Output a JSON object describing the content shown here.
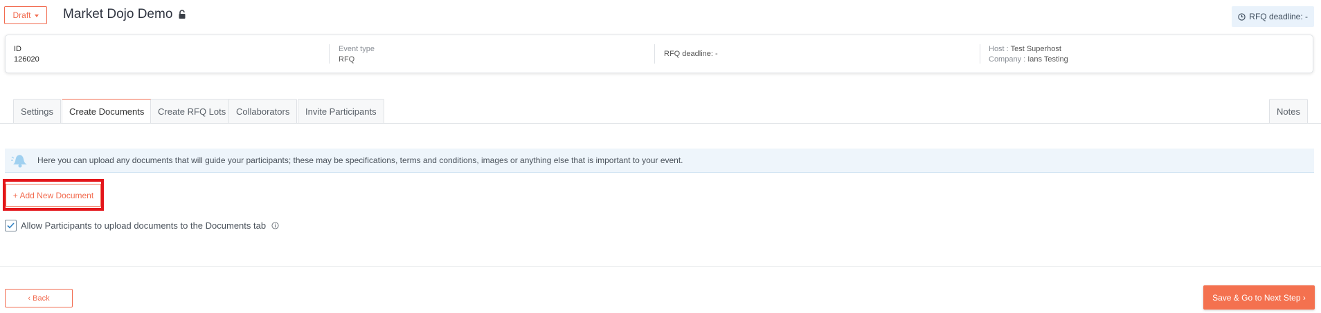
{
  "header": {
    "status_label": "Draft",
    "event_title": "Market Dojo Demo",
    "deadline_label": "RFQ deadline: -"
  },
  "info_card": {
    "id_label": "ID",
    "id_value": "126020",
    "event_type_label": "Event type",
    "event_type_value": "RFQ",
    "rfq_deadline": "RFQ deadline: -",
    "host_label": "Host : ",
    "host_value": "Test Superhost",
    "company_label": "Company : ",
    "company_value": "Ians Testing"
  },
  "tabs": [
    {
      "label": "Settings"
    },
    {
      "label": "Create Documents",
      "active": true
    },
    {
      "label": "Create RFQ Lots"
    },
    {
      "label": "Collaborators"
    },
    {
      "label": "Invite Participants"
    },
    {
      "label": "Notes"
    }
  ],
  "banner": {
    "text": "Here you can upload any documents that will guide your participants; these may be specifications, terms and conditions, images or anything else that is important to your event."
  },
  "documents": {
    "add_button_label": "+ Add New Document",
    "allow_upload_label": "Allow Participants to upload documents to the Documents tab",
    "allow_upload_checked": true
  },
  "footer": {
    "back_label": "‹ Back",
    "next_label": "Save & Go to Next Step ›"
  },
  "colors": {
    "accent": "#f26b4f",
    "highlight": "#e3151a",
    "banner_bg": "#eef5fb"
  },
  "icons": [
    "caret-down-icon",
    "lock-icon",
    "clock-icon",
    "bell-icon",
    "checkmark-icon",
    "info-icon"
  ]
}
